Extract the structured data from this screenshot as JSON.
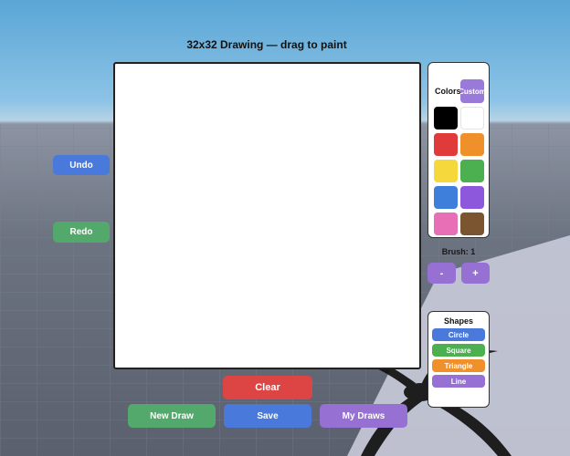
{
  "title": "32x32 Drawing — drag to paint",
  "buttons": {
    "undo": "Undo",
    "redo": "Redo",
    "clear": "Clear",
    "new_draw": "New Draw",
    "save": "Save",
    "my_draws": "My Draws"
  },
  "colors_panel": {
    "title": "Colors",
    "custom_label": "Custom",
    "swatches": [
      "#000000",
      "#ffffff",
      "#e03a3a",
      "#f0902a",
      "#f5d93c",
      "#4caf50",
      "#3f7fdc",
      "#8e58dc",
      "#e86fb6",
      "#7b5530"
    ]
  },
  "brush": {
    "label": "Brush: 1",
    "minus": "-",
    "plus": "+"
  },
  "shapes_panel": {
    "title": "Shapes",
    "items": [
      {
        "label": "Circle",
        "color": "#4a79dc"
      },
      {
        "label": "Square",
        "color": "#4caf50"
      },
      {
        "label": "Triangle",
        "color": "#f0902a"
      },
      {
        "label": "Line",
        "color": "#9670d3"
      }
    ]
  }
}
